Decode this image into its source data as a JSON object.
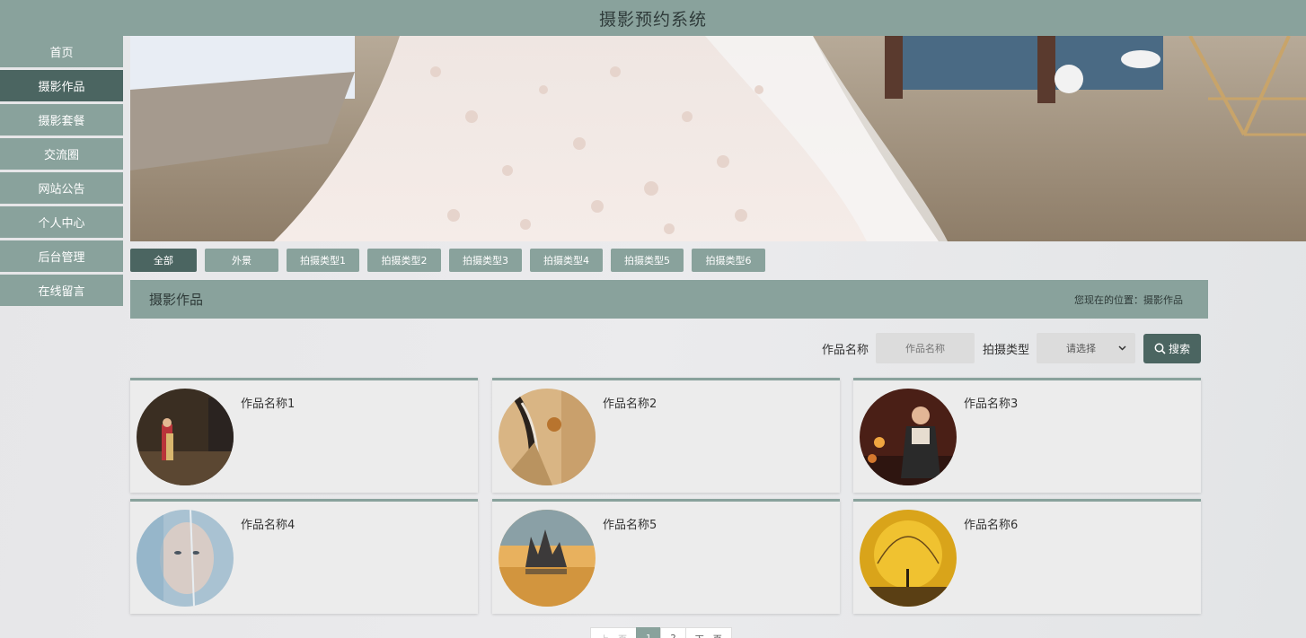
{
  "header": {
    "title": "摄影预约系统"
  },
  "sidebar": {
    "items": [
      {
        "label": "首页"
      },
      {
        "label": "摄影作品"
      },
      {
        "label": "摄影套餐"
      },
      {
        "label": "交流圈"
      },
      {
        "label": "网站公告"
      },
      {
        "label": "个人中心"
      },
      {
        "label": "后台管理"
      },
      {
        "label": "在线留言"
      }
    ],
    "active_index": 1
  },
  "tabs": [
    {
      "label": "全部"
    },
    {
      "label": "外景"
    },
    {
      "label": "拍摄类型1"
    },
    {
      "label": "拍摄类型2"
    },
    {
      "label": "拍摄类型3"
    },
    {
      "label": "拍摄类型4"
    },
    {
      "label": "拍摄类型5"
    },
    {
      "label": "拍摄类型6"
    }
  ],
  "section": {
    "title": "摄影作品",
    "location_prefix": "您现在的位置：",
    "location_value": "摄影作品"
  },
  "search": {
    "name_label": "作品名称",
    "name_placeholder": "作品名称",
    "type_label": "拍摄类型",
    "type_selected": "请选择",
    "button_label": "搜索"
  },
  "works": [
    {
      "title": "作品名称1"
    },
    {
      "title": "作品名称2"
    },
    {
      "title": "作品名称3"
    },
    {
      "title": "作品名称4"
    },
    {
      "title": "作品名称5"
    },
    {
      "title": "作品名称6"
    }
  ],
  "pager": {
    "prev_label": "上一页",
    "pages": [
      "1",
      "2"
    ],
    "next_label": "下一页",
    "current_page": "1"
  },
  "colors": {
    "accent": "#89a29c",
    "accent_dark": "#4b6561"
  }
}
